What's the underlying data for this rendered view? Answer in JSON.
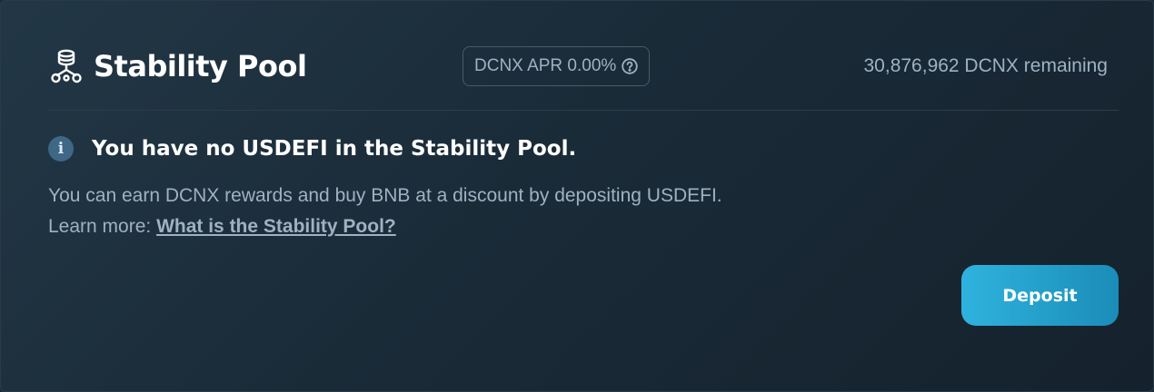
{
  "header": {
    "icon": "stability-pool-icon",
    "title": "Stability Pool",
    "apr_label": "DCNX APR 0.00%",
    "apr_help_icon": "question-circle-icon",
    "remaining": "30,876,962 DCNX remaining"
  },
  "info": {
    "icon": "info-icon",
    "icon_glyph": "i",
    "heading": "You have no USDEFI in the Stability Pool.",
    "description": "You can earn DCNX rewards and buy BNB at a discount by depositing USDEFI.",
    "learn_more_prefix": "Learn more: ",
    "learn_more_link": "What is the Stability Pool?"
  },
  "actions": {
    "deposit_label": "Deposit"
  },
  "colors": {
    "accent": "#2fb3de",
    "muted_text": "#9eb2c2",
    "card_bg": "#1a2b38"
  }
}
